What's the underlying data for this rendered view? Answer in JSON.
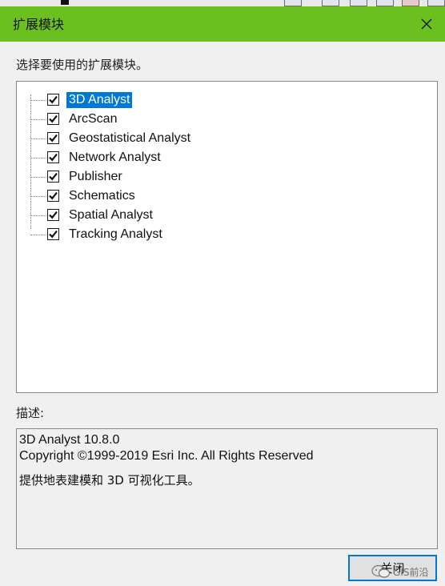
{
  "dialog": {
    "title": "扩展模块",
    "instruction": "选择要使用的扩展模块。",
    "description_label": "描述:",
    "close_button_label": "关闭"
  },
  "extensions": [
    {
      "name": "3D Analyst",
      "checked": true,
      "selected": true
    },
    {
      "name": "ArcScan",
      "checked": true,
      "selected": false
    },
    {
      "name": "Geostatistical Analyst",
      "checked": true,
      "selected": false
    },
    {
      "name": "Network Analyst",
      "checked": true,
      "selected": false
    },
    {
      "name": "Publisher",
      "checked": true,
      "selected": false
    },
    {
      "name": "Schematics",
      "checked": true,
      "selected": false
    },
    {
      "name": "Spatial Analyst",
      "checked": true,
      "selected": false
    },
    {
      "name": "Tracking Analyst",
      "checked": true,
      "selected": false
    }
  ],
  "description": {
    "version": "3D Analyst 10.8.0",
    "copyright": "Copyright ©1999-2019 Esri Inc. All Rights Reserved",
    "text": "提供地表建模和 3D 可视化工具。"
  },
  "watermark": {
    "text": "GIS前沿"
  },
  "colors": {
    "titlebar": "#6bbf1f",
    "selection": "#0078d7",
    "button_border": "#0078d7"
  }
}
